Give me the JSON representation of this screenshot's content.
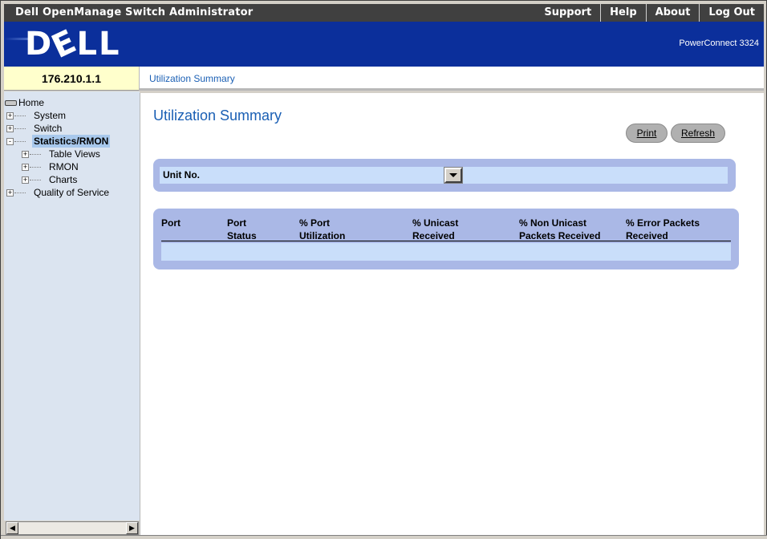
{
  "app": {
    "title": "Dell OpenManage Switch Administrator",
    "menu": [
      {
        "label": "Support"
      },
      {
        "label": "Help"
      },
      {
        "label": "About"
      },
      {
        "label": "Log Out"
      }
    ]
  },
  "banner": {
    "logo_text": "DELL",
    "model": "PowerConnect 3324",
    "color": "#0b2f9b"
  },
  "device": {
    "ip": "176.210.1.1"
  },
  "breadcrumb": "Utilization Summary",
  "nav": {
    "home": "Home",
    "items": [
      {
        "label": "System",
        "expander": "+",
        "icon": "plus-box-icon"
      },
      {
        "label": "Switch",
        "expander": "+",
        "icon": "plus-box-icon"
      },
      {
        "label": "Statistics/RMON",
        "expander": "-",
        "icon": "minus-box-icon",
        "selected": true,
        "children": [
          {
            "label": "Table Views",
            "expander": "+"
          },
          {
            "label": "RMON",
            "expander": "+"
          },
          {
            "label": "Charts",
            "expander": "+"
          }
        ]
      },
      {
        "label": "Quality of Service",
        "expander": "+",
        "icon": "plus-box-icon"
      }
    ]
  },
  "main": {
    "title": "Utilization Summary",
    "buttons": {
      "print": "Print",
      "refresh": "Refresh"
    },
    "unit": {
      "label": "Unit No.",
      "value": ""
    },
    "table": {
      "columns": [
        {
          "line1": "Port",
          "line2": ""
        },
        {
          "line1": "Port",
          "line2": "Status"
        },
        {
          "line1": "% Port",
          "line2": "Utilization"
        },
        {
          "line1": "% Unicast",
          "line2": "Received"
        },
        {
          "line1": "% Non Unicast",
          "line2": "Packets Received"
        },
        {
          "line1": "% Error Packets",
          "line2": "Received"
        }
      ],
      "rows": []
    }
  },
  "colors": {
    "title_blue": "#1a5fb4",
    "panel": "#aab8e6",
    "panel_inner": "#c9defa",
    "ip_box": "#ffffcc",
    "nav_bg": "#dbe4f0"
  }
}
